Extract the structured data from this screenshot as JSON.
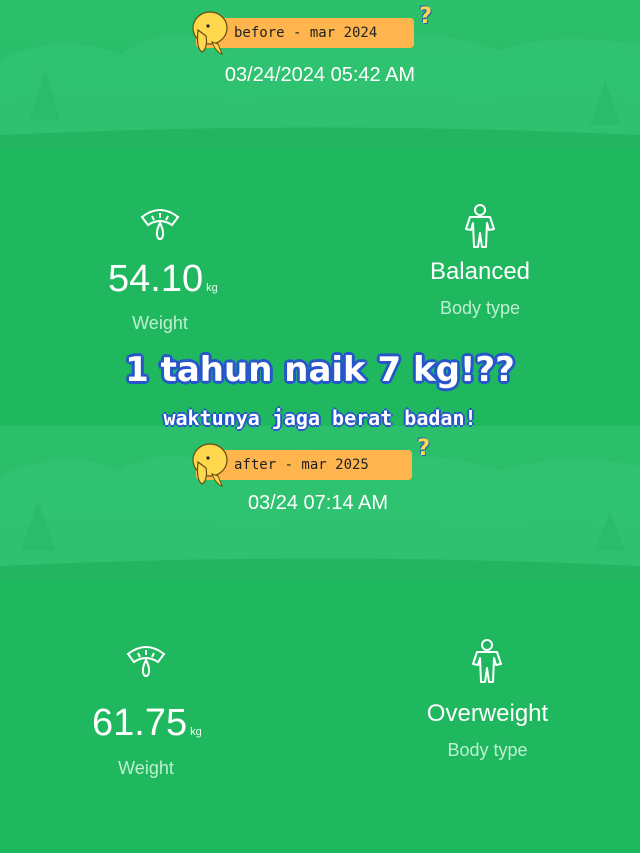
{
  "before": {
    "tag": "before - mar 2024",
    "datetime": "03/24/2024 05:42 AM",
    "weight": {
      "value": "54.10",
      "unit": "kg",
      "label": "Weight"
    },
    "body_type": {
      "value": "Balanced",
      "label": "Body type"
    }
  },
  "overlay": {
    "headline": "1 tahun naik 7 kg!??",
    "subline": "waktunya jaga berat badan!"
  },
  "after": {
    "tag": "after - mar 2025",
    "datetime": "03/24 07:14 AM",
    "weight": {
      "value": "61.75",
      "unit": "kg",
      "label": "Weight"
    },
    "body_type": {
      "value": "Overweight",
      "label": "Body type"
    }
  },
  "decor": {
    "question_mark": "?",
    "icons": [
      "scale-icon",
      "person-icon",
      "mascot-icon"
    ]
  },
  "colors": {
    "background": "#1fb85f",
    "tag": "#ffb54d",
    "outline": "#2656c9",
    "label": "#bff0d1"
  }
}
